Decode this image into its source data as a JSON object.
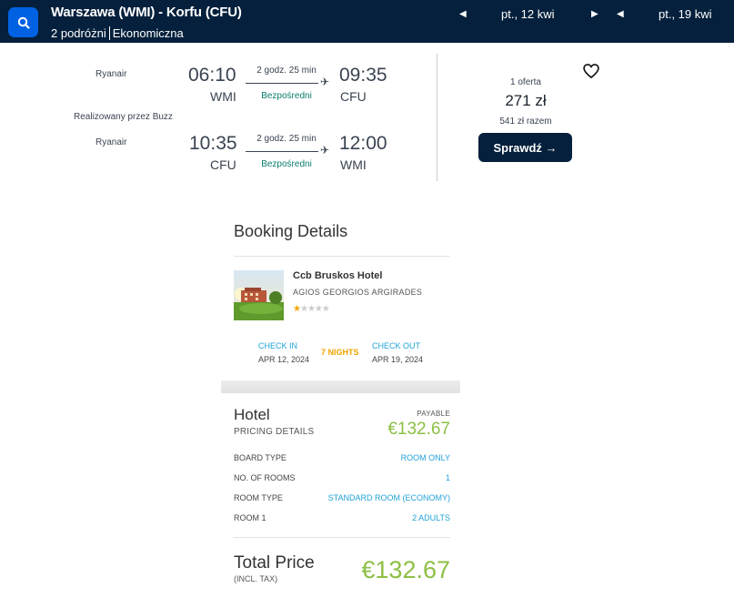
{
  "header": {
    "route": "Warszawa (WMI) - Korfu (CFU)",
    "travelers": "2 podróżni",
    "cabin": "Ekonomiczna",
    "depart_date": "pt., 12 kwi",
    "return_date": "pt., 19 kwi",
    "icons": [
      "search-icon",
      "chevron-left-icon",
      "chevron-right-icon"
    ]
  },
  "flight": {
    "outbound": {
      "airline": "Ryanair",
      "dep_time": "06:10",
      "dep_code": "WMI",
      "duration": "2 godz. 25 min",
      "stops": "Bezpośredni",
      "arr_time": "09:35",
      "arr_code": "CFU"
    },
    "operated_by": "Realizowany przez Buzz",
    "inbound": {
      "airline": "Ryanair",
      "dep_time": "10:35",
      "dep_code": "CFU",
      "duration": "2 godz. 25 min",
      "stops": "Bezpośredni",
      "arr_time": "12:00",
      "arr_code": "WMI"
    },
    "offers": "1 oferta",
    "price": "271 zł",
    "total": "541 zł razem",
    "check_label": "Sprawdź →"
  },
  "booking": {
    "title": "Booking Details",
    "hotel_name": "Ccb Bruskos Hotel",
    "hotel_location": "AGIOS GEORGIOS ARGIRADES",
    "rating": 1,
    "rating_max": 5,
    "checkin_label": "CHECK IN",
    "checkin_date": "APR 12, 2024",
    "nights": "7 NIGHTS",
    "checkout_label": "CHECK OUT",
    "checkout_date": "APR 19, 2024"
  },
  "pricing": {
    "title": "Hotel",
    "subtitle": "PRICING DETAILS",
    "payable_label": "PAYABLE",
    "payable_value": "€132.67",
    "rows": [
      {
        "label": "BOARD TYPE",
        "value": "ROOM ONLY"
      },
      {
        "label": "NO. OF ROOMS",
        "value": "1"
      },
      {
        "label": "ROOM TYPE",
        "value": "STANDARD ROOM (ECONOMY)"
      },
      {
        "label": "ROOM 1",
        "value": "2 ADULTS"
      }
    ],
    "total_label": "Total Price",
    "total_note": "(INCL. TAX)",
    "total_value": "€132.67"
  },
  "colors": {
    "navy": "#05203c",
    "blue": "#0062e3",
    "green": "#8dbf44",
    "link": "#21a2d8",
    "star": "#f0a500"
  }
}
